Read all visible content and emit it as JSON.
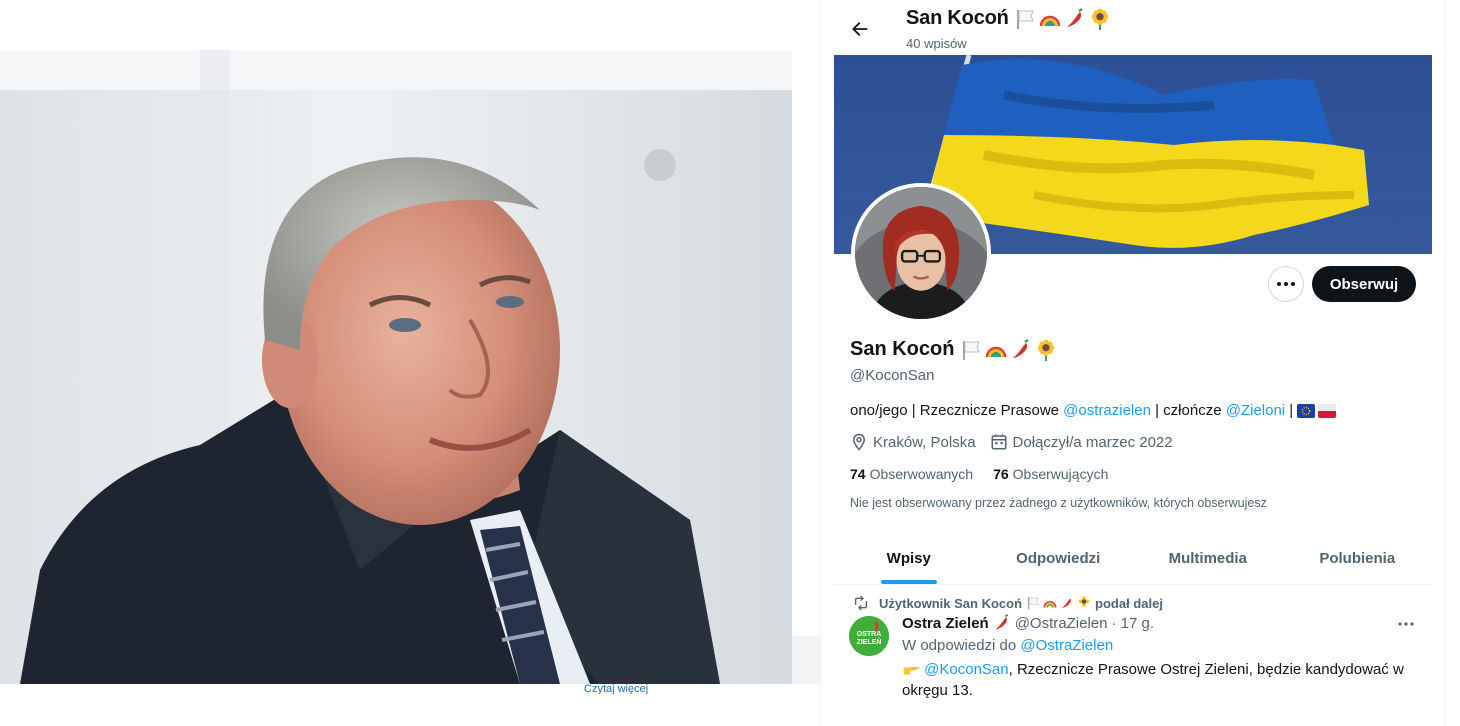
{
  "photo": {
    "caption": "Czytaj więcej"
  },
  "header": {
    "name": "San Kocoń",
    "count": "40 wpisów"
  },
  "profile": {
    "name": "San Kocoń",
    "handle": "@KoconSan",
    "bio_1": "ono/jego | Rzecznicze Prasowe ",
    "bio_link_1": "@ostrazielen",
    "bio_2": " | człończe ",
    "bio_link_2": "@Zieloni",
    "bio_3": " | ",
    "location": "Kraków, Polska",
    "joined": "Dołączył/a marzec 2022",
    "following_count": "74",
    "following_label": "Obserwowanych",
    "followers_count": "76",
    "followers_label": "Obserwujących",
    "not_followed": "Nie jest obserwowany przez żadnego z użytkowników, których obserwujesz",
    "follow_label": "Obserwuj"
  },
  "tabs": [
    "Wpisy",
    "Odpowiedzi",
    "Multimedia",
    "Polubienia"
  ],
  "tweet": {
    "retweet_prefix": "Użytkownik San Kocoń",
    "retweet_suffix": "podał dalej",
    "author": "Ostra Zieleń",
    "handle": "@OstraZielen",
    "time": "· 17 g.",
    "reply_prefix": "W odpowiedzi do",
    "reply_handle": "@OstraZielen",
    "mention": "@KoconSan",
    "text": ", Rzecznicze Prasowe Ostrej Zieleni, będzie kandydować w okręgu 13.",
    "avatar_text_1": "OSTRA",
    "avatar_text_2": "ZIELEŃ"
  },
  "colors": {
    "accent": "#1d9bf0",
    "text": "#0f1419",
    "muted": "#536471",
    "follow_button": "#0f1419"
  },
  "icons": [
    "back-arrow-icon",
    "more-icon",
    "location-icon",
    "calendar-icon",
    "retweet-icon",
    "white-flag-emoji",
    "rainbow-emoji",
    "chili-emoji",
    "sunflower-emoji",
    "eu-flag-emoji",
    "poland-flag-emoji",
    "point-right-emoji"
  ]
}
